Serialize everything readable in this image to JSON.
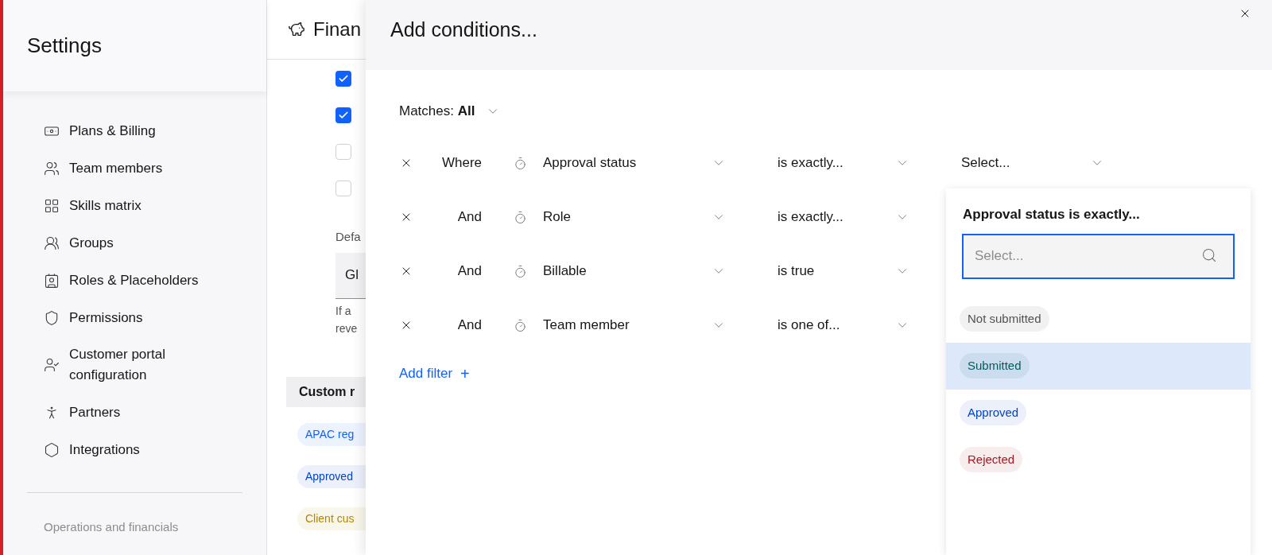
{
  "sidebar": {
    "title": "Settings",
    "items": [
      {
        "label": "Plans & Billing"
      },
      {
        "label": "Team members"
      },
      {
        "label": "Skills matrix"
      },
      {
        "label": "Groups"
      },
      {
        "label": "Roles & Placeholders"
      },
      {
        "label": "Permissions"
      },
      {
        "label": "Customer portal configuration"
      },
      {
        "label": "Partners"
      },
      {
        "label": "Integrations"
      }
    ],
    "section_heading": "Operations and financials"
  },
  "page": {
    "title": "Finan",
    "checkboxes": [
      {
        "checked": true
      },
      {
        "checked": true
      },
      {
        "checked": false
      },
      {
        "checked": false
      }
    ],
    "field_label": "Defa",
    "field_value": "Gl",
    "help_lines": [
      "If a",
      "reve"
    ],
    "table_header": "Custom r",
    "tags": [
      {
        "label": "APAC reg",
        "color": "#0f62fe"
      },
      {
        "label": "Approved",
        "color": "#0043ce"
      },
      {
        "label": "Client cus",
        "color": "#b28600"
      }
    ]
  },
  "panel": {
    "title": "Add conditions...",
    "matches": {
      "label": "Matches:",
      "value": "All"
    },
    "conditions": [
      {
        "conjunction": "Where",
        "field": "Approval status",
        "operator": "is exactly...",
        "value": "Select..."
      },
      {
        "conjunction": "And",
        "field": "Role",
        "operator": "is exactly..."
      },
      {
        "conjunction": "And",
        "field": "Billable",
        "operator": "is true"
      },
      {
        "conjunction": "And",
        "field": "Team member",
        "operator": "is one of..."
      }
    ],
    "add_filter": "Add filter",
    "add_icon": "+",
    "dropdown": {
      "title": "Approval status is exactly...",
      "placeholder": "Select...",
      "options": [
        {
          "label": "Not submitted",
          "color": "#525252",
          "selected": false
        },
        {
          "label": "Submitted",
          "color": "#005d5d",
          "selected": true
        },
        {
          "label": "Approved",
          "color": "#0043ce",
          "selected": false
        },
        {
          "label": "Rejected",
          "color": "#a2191f",
          "selected": false
        }
      ]
    }
  }
}
